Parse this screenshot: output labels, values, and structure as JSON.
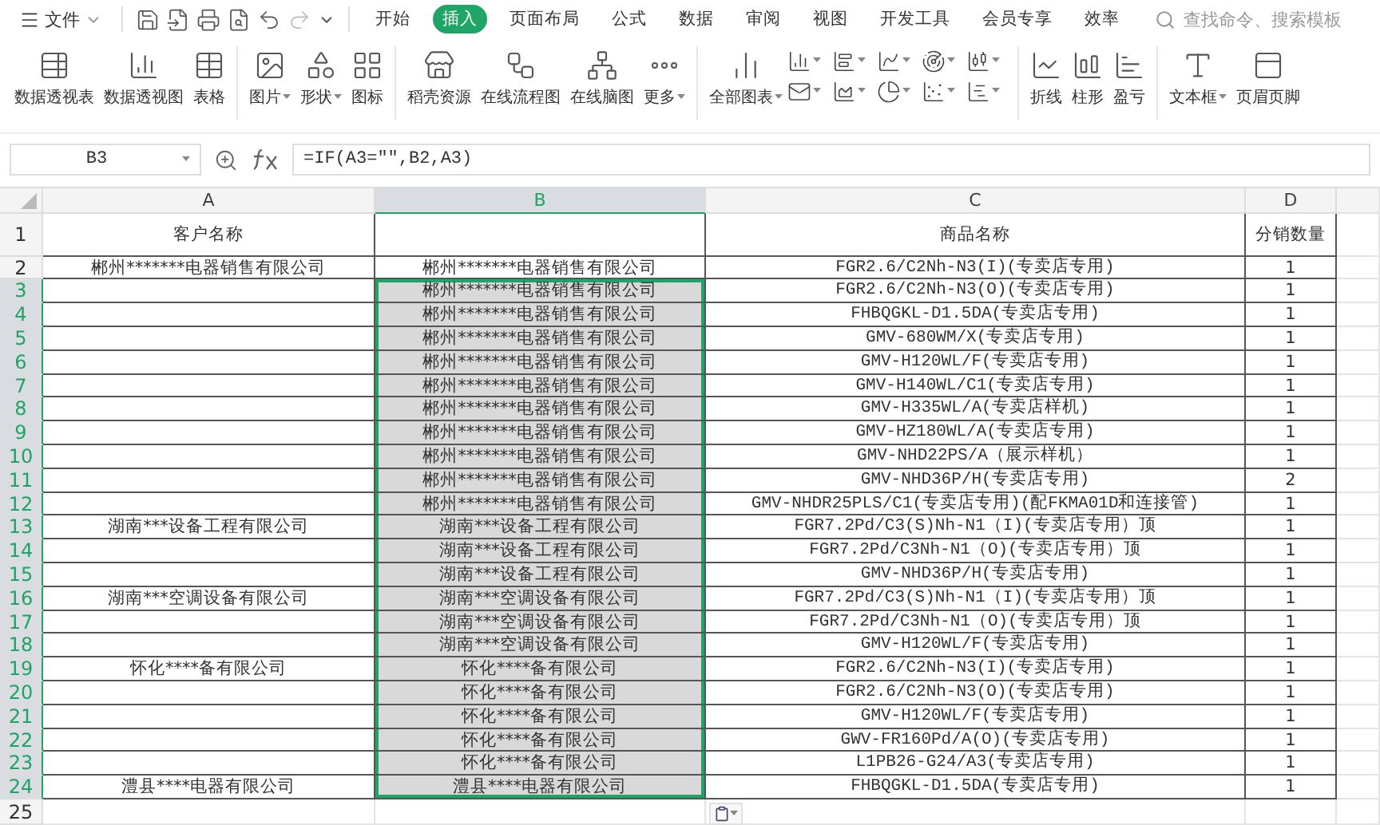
{
  "menu": {
    "file": "文件"
  },
  "tabs": [
    {
      "label": "开始",
      "selected": false
    },
    {
      "label": "插入",
      "selected": true
    },
    {
      "label": "页面布局",
      "selected": false
    },
    {
      "label": "公式",
      "selected": false
    },
    {
      "label": "数据",
      "selected": false
    },
    {
      "label": "审阅",
      "selected": false
    },
    {
      "label": "视图",
      "selected": false
    },
    {
      "label": "开发工具",
      "selected": false
    },
    {
      "label": "会员专享",
      "selected": false
    },
    {
      "label": "效率",
      "selected": false
    }
  ],
  "search": {
    "placeholder": "查找命令、搜索模板"
  },
  "ribbon": [
    {
      "label": "数据透视表",
      "dropdown": false
    },
    {
      "label": "数据透视图",
      "dropdown": false
    },
    {
      "label": "表格",
      "dropdown": false
    },
    {
      "label": "图片",
      "dropdown": true
    },
    {
      "label": "形状",
      "dropdown": true
    },
    {
      "label": "图标",
      "dropdown": false
    },
    {
      "label": "稻壳资源",
      "dropdown": false
    },
    {
      "label": "在线流程图",
      "dropdown": false
    },
    {
      "label": "在线脑图",
      "dropdown": false
    },
    {
      "label": "更多",
      "dropdown": true
    },
    {
      "label": "全部图表",
      "dropdown": true
    },
    {
      "label": "折线",
      "dropdown": false
    },
    {
      "label": "柱形",
      "dropdown": false
    },
    {
      "label": "盈亏",
      "dropdown": false
    },
    {
      "label": "文本框",
      "dropdown": true
    },
    {
      "label": "页眉页脚",
      "dropdown": false
    }
  ],
  "formula_bar": {
    "name_box": "B3",
    "formula": "=IF(A3=\"\",B2,A3)"
  },
  "columns": [
    {
      "label": "A",
      "selected": false
    },
    {
      "label": "B",
      "selected": true
    },
    {
      "label": "C",
      "selected": false
    },
    {
      "label": "D",
      "selected": false
    }
  ],
  "rows": [
    {
      "number": "1",
      "selected": false,
      "a": "客户名称",
      "c": "商品名称",
      "d": "分销数量"
    },
    {
      "number": "2",
      "selected": false,
      "a": "郴州*******电器销售有限公司",
      "b": "郴州*******电器销售有限公司",
      "c": "FGR2.6/C2Nh-N3(I)(专卖店专用)",
      "d": "1"
    },
    {
      "number": "3",
      "selected": true,
      "b": "郴州*******电器销售有限公司",
      "c": "FGR2.6/C2Nh-N3(O)(专卖店专用)",
      "d": "1"
    },
    {
      "number": "4",
      "selected": true,
      "b": "郴州*******电器销售有限公司",
      "c": "FHBQGKL-D1.5DA(专卖店专用)",
      "d": "1"
    },
    {
      "number": "5",
      "selected": true,
      "b": "郴州*******电器销售有限公司",
      "c": "GMV-680WM/X(专卖店专用)",
      "d": "1"
    },
    {
      "number": "6",
      "selected": true,
      "b": "郴州*******电器销售有限公司",
      "c": "GMV-H120WL/F(专卖店专用)",
      "d": "1"
    },
    {
      "number": "7",
      "selected": true,
      "b": "郴州*******电器销售有限公司",
      "c": "GMV-H140WL/C1(专卖店专用)",
      "d": "1"
    },
    {
      "number": "8",
      "selected": true,
      "b": "郴州*******电器销售有限公司",
      "c": "GMV-H335WL/A(专卖店样机)",
      "d": "1"
    },
    {
      "number": "9",
      "selected": true,
      "b": "郴州*******电器销售有限公司",
      "c": "GMV-HZ180WL/A(专卖店专用)",
      "d": "1"
    },
    {
      "number": "10",
      "selected": true,
      "b": "郴州*******电器销售有限公司",
      "c": "GMV-NHD22PS/A（展示样机）",
      "d": "1"
    },
    {
      "number": "11",
      "selected": true,
      "b": "郴州*******电器销售有限公司",
      "c": "GMV-NHD36P/H(专卖店专用)",
      "d": "2"
    },
    {
      "number": "12",
      "selected": true,
      "b": "郴州*******电器销售有限公司",
      "c": "GMV-NHDR25PLS/C1(专卖店专用)(配FKMA01D和连接管)",
      "d": "1"
    },
    {
      "number": "13",
      "selected": true,
      "a": "湖南***设备工程有限公司",
      "b": "湖南***设备工程有限公司",
      "c": "FGR7.2Pd/C3(S)Nh-N1（I)(专卖店专用）顶",
      "d": "1"
    },
    {
      "number": "14",
      "selected": true,
      "b": "湖南***设备工程有限公司",
      "c": "FGR7.2Pd/C3Nh-N1（O)(专卖店专用）顶",
      "d": "1"
    },
    {
      "number": "15",
      "selected": true,
      "b": "湖南***设备工程有限公司",
      "c": "GMV-NHD36P/H(专卖店专用)",
      "d": "1"
    },
    {
      "number": "16",
      "selected": true,
      "a": "湖南***空调设备有限公司",
      "b": "湖南***空调设备有限公司",
      "c": "FGR7.2Pd/C3(S)Nh-N1（I)(专卖店专用）顶",
      "d": "1"
    },
    {
      "number": "17",
      "selected": true,
      "b": "湖南***空调设备有限公司",
      "c": "FGR7.2Pd/C3Nh-N1（O)(专卖店专用）顶",
      "d": "1"
    },
    {
      "number": "18",
      "selected": true,
      "b": "湖南***空调设备有限公司",
      "c": "GMV-H120WL/F(专卖店专用)",
      "d": "1"
    },
    {
      "number": "19",
      "selected": true,
      "a": "怀化****备有限公司",
      "b": "怀化****备有限公司",
      "c": "FGR2.6/C2Nh-N3(I)(专卖店专用)",
      "d": "1"
    },
    {
      "number": "20",
      "selected": true,
      "b": "怀化****备有限公司",
      "c": "FGR2.6/C2Nh-N3(O)(专卖店专用)",
      "d": "1"
    },
    {
      "number": "21",
      "selected": true,
      "b": "怀化****备有限公司",
      "c": "GMV-H120WL/F(专卖店专用)",
      "d": "1"
    },
    {
      "number": "22",
      "selected": true,
      "b": "怀化****备有限公司",
      "c": "GWV-FR160Pd/A(O)(专卖店专用)",
      "d": "1"
    },
    {
      "number": "23",
      "selected": true,
      "b": "怀化****备有限公司",
      "c": "L1PB26-G24/A3(专卖店专用)",
      "d": "1"
    },
    {
      "number": "24",
      "selected": true,
      "a": "澧县****电器有限公司",
      "b": "澧县****电器有限公司",
      "c": "FHBQGKL-D1.5DA(专卖店专用)",
      "d": "1"
    },
    {
      "number": "25",
      "selected": false
    }
  ]
}
